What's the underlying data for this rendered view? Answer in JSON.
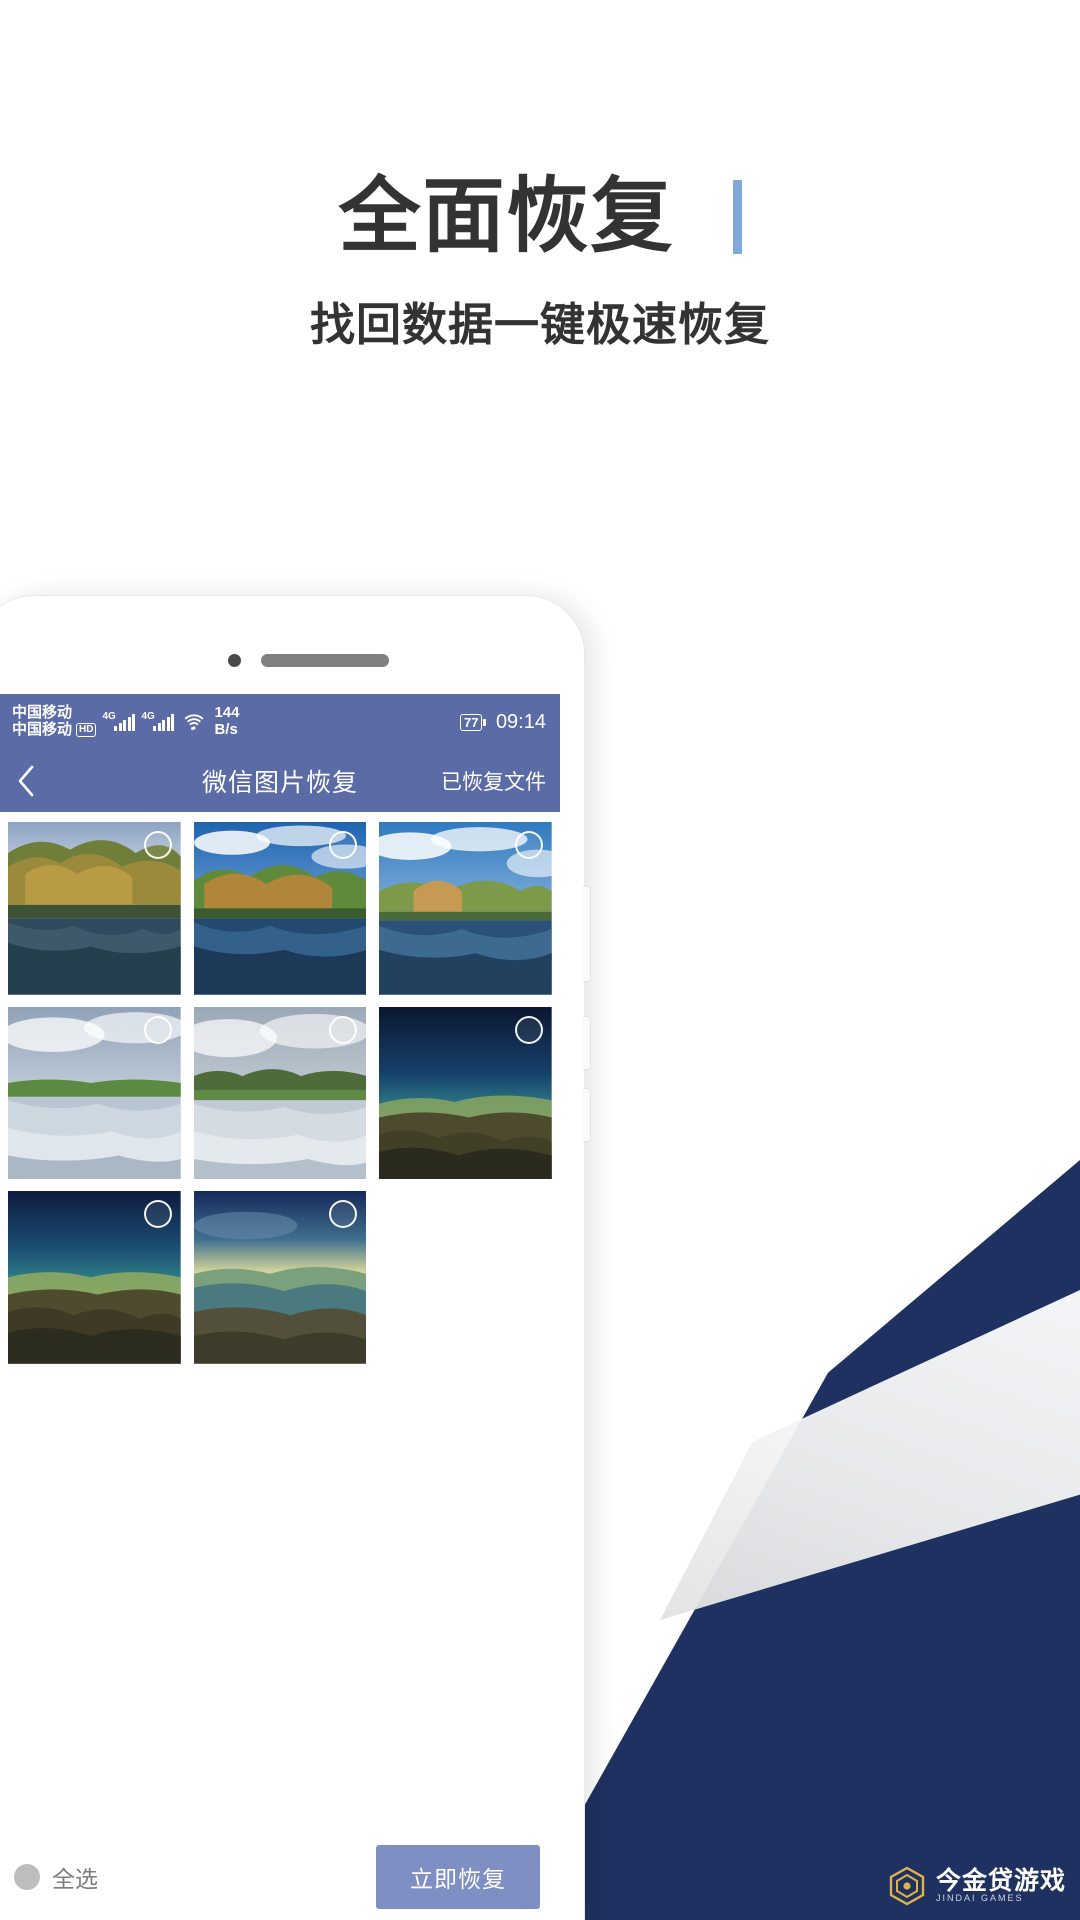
{
  "promo": {
    "title": "全面恢复",
    "subtitle": "找回数据一键极速恢复",
    "accent_color": "#7fa8dd",
    "title_color": "#333333"
  },
  "phone": {
    "status_bar": {
      "carrier_primary": "中国移动",
      "carrier_secondary": "中国移动",
      "hd_badge": "HD",
      "network_type_1": "4G",
      "network_type_2": "4G",
      "wifi_icon": "wifi-icon",
      "net_speed_value": "144",
      "net_speed_unit": "B/s",
      "battery_level": "77",
      "time": "09:14",
      "background_color": "#5b6ba6"
    },
    "nav_bar": {
      "back_icon": "chevron-left-icon",
      "title": "微信图片恢复",
      "action_label": "已恢复文件",
      "background_color": "#5b6ba6"
    },
    "gallery": {
      "checkbox_icon": "circle-unchecked-icon",
      "items": [
        {
          "id": "photo-1",
          "label": "湖边秋树倒影",
          "selected": false,
          "palette": [
            "#7a8fb4",
            "#c9d4e2",
            "#4e6b3a",
            "#8a7b3c",
            "#2f4a5c"
          ]
        },
        {
          "id": "photo-2",
          "label": "蓝天树林湖泊",
          "selected": false,
          "palette": [
            "#2f6fb5",
            "#dfe8f2",
            "#6a8c3e",
            "#b08a3a",
            "#1e3d57"
          ]
        },
        {
          "id": "photo-3",
          "label": "晴空湖畔树丛",
          "selected": false,
          "palette": [
            "#3a7ec0",
            "#e8eef6",
            "#7c9a4a",
            "#c1a25a",
            "#24455f"
          ]
        },
        {
          "id": "photo-4",
          "label": "草原云影湖面",
          "selected": false,
          "palette": [
            "#9fb2c6",
            "#e4ebf2",
            "#6f9a4c",
            "#cfd8e0",
            "#39536b"
          ]
        },
        {
          "id": "photo-5",
          "label": "阴天草地湖景",
          "selected": false,
          "palette": [
            "#a8b6c4",
            "#dfe5ea",
            "#5f8a45",
            "#c6ced6",
            "#44596d"
          ]
        },
        {
          "id": "photo-6",
          "label": "高原山脊远景",
          "selected": false,
          "palette": [
            "#0e1c3a",
            "#2a5f6e",
            "#6d8f4e",
            "#5a5234",
            "#2b2a22"
          ]
        },
        {
          "id": "photo-7",
          "label": "暮色荒原山地",
          "selected": false,
          "palette": [
            "#12224a",
            "#2d6b73",
            "#7b9a54",
            "#6a5f3a",
            "#3a3528"
          ]
        },
        {
          "id": "photo-8",
          "label": "黄昏湖湾海岸",
          "selected": false,
          "palette": [
            "#1a2d55",
            "#e3d79a",
            "#78a07e",
            "#3f6f7a",
            "#4a4531"
          ]
        }
      ]
    },
    "bottom_bar": {
      "select_all_label": "全选",
      "select_all_checked": false,
      "recover_button_label": "立即恢复",
      "recover_button_color": "#7f8fc4"
    }
  },
  "watermark": {
    "logo_icon": "hex-logo-icon",
    "name_cn": "今金贷游戏",
    "name_en": "JINDAI GAMES"
  },
  "background": {
    "navy_color": "#1f3160",
    "page_color": "#ffffff"
  }
}
